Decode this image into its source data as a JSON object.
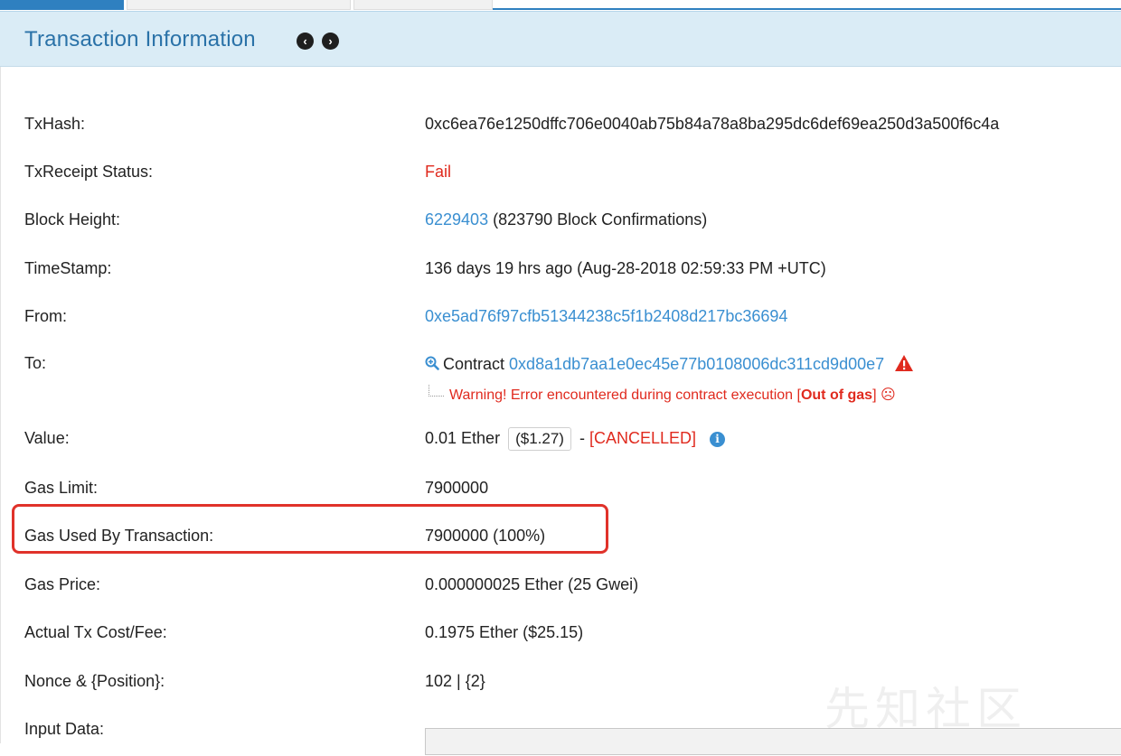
{
  "panel": {
    "title": "Transaction Information",
    "prev_icon": "chevron-left-circle-icon",
    "next_icon": "chevron-right-circle-icon"
  },
  "rows": {
    "txhash": {
      "label": "TxHash:",
      "value": "0xc6ea76e1250dffc706e0040ab75b84a78a8ba295dc6def69ea250d3a500f6c4a"
    },
    "status": {
      "label": "TxReceipt Status:",
      "value": "Fail"
    },
    "block": {
      "label": "Block Height:",
      "block_number": "6229403",
      "confirmations": "(823790 Block Confirmations)"
    },
    "timestamp": {
      "label": "TimeStamp:",
      "value": "136 days 19 hrs ago (Aug-28-2018 02:59:33 PM +UTC)"
    },
    "from": {
      "label": "From:",
      "address": "0xe5ad76f97cfb51344238c5f1b2408d217bc36694"
    },
    "to": {
      "label": "To:",
      "prefix": "Contract",
      "address": "0xd8a1db7aa1e0ec45e77b0108006dc311cd9d00e7",
      "warning_prefix": "Warning! Error encountered during contract execution [",
      "warning_bold": "Out of gas",
      "warning_suffix": "] ☹"
    },
    "value": {
      "label": "Value:",
      "amount": "0.01 Ether",
      "usd": "($1.27)",
      "dash": "-",
      "status": "[CANCELLED]",
      "info": "i"
    },
    "gas_limit": {
      "label": "Gas Limit:",
      "value": "7900000"
    },
    "gas_used": {
      "label": "Gas Used By Transaction:",
      "value": "7900000 (100%)"
    },
    "gas_price": {
      "label": "Gas Price:",
      "value": "0.000000025 Ether (25 Gwei)"
    },
    "tx_fee": {
      "label": "Actual Tx Cost/Fee:",
      "value": "0.1975 Ether ($25.15)"
    },
    "nonce": {
      "label": "Nonce & {Position}:",
      "value": "102 | {2}"
    },
    "input": {
      "label": "Input Data:"
    }
  },
  "watermark": "先知社区",
  "colors": {
    "link": "#3a8fd1",
    "error": "#e02a1e",
    "header_bg": "#daecf6",
    "title": "#2a72a8",
    "highlight": "#e0322a"
  }
}
